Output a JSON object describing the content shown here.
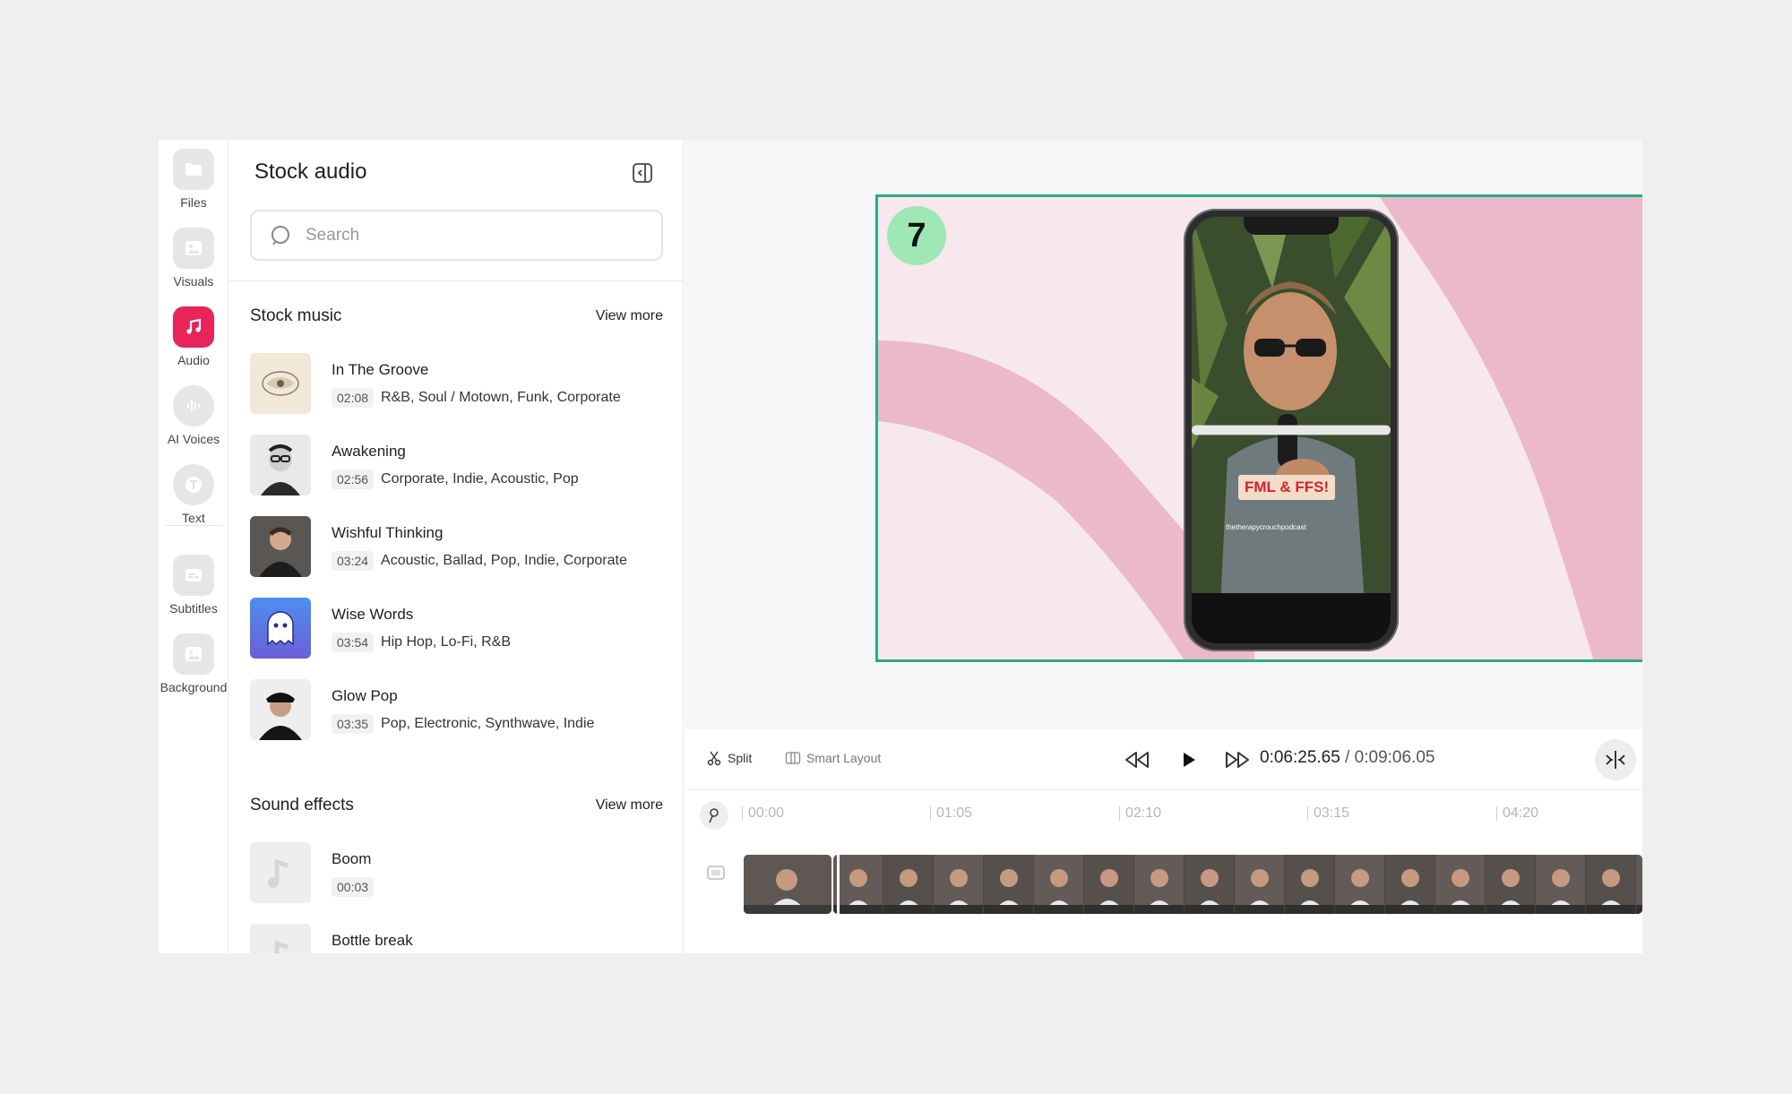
{
  "rail": {
    "items": [
      {
        "label": "Files",
        "icon": "folder-icon"
      },
      {
        "label": "Visuals",
        "icon": "image-icon"
      },
      {
        "label": "Audio",
        "icon": "music-note-icon",
        "active": true
      },
      {
        "label": "AI Voices",
        "icon": "waveform-icon"
      },
      {
        "label": "Text",
        "icon": "text-icon"
      },
      {
        "label": "Subtitles",
        "icon": "subtitles-icon"
      },
      {
        "label": "Background",
        "icon": "background-image-icon"
      }
    ]
  },
  "panel": {
    "title": "Stock audio",
    "search_placeholder": "Search",
    "stock_music": {
      "title": "Stock music",
      "view_more": "View more",
      "tracks": [
        {
          "name": "In The Groove",
          "duration": "02:08",
          "tags": "R&B, Soul / Motown, Funk, Corporate"
        },
        {
          "name": "Awakening",
          "duration": "02:56",
          "tags": "Corporate, Indie, Acoustic, Pop"
        },
        {
          "name": "Wishful Thinking",
          "duration": "03:24",
          "tags": "Acoustic, Ballad, Pop, Indie, Corporate"
        },
        {
          "name": "Wise Words",
          "duration": "03:54",
          "tags": "Hip Hop, Lo-Fi, R&B"
        },
        {
          "name": "Glow Pop",
          "duration": "03:35",
          "tags": "Pop, Electronic, Synthwave, Indie"
        }
      ]
    },
    "sound_effects": {
      "title": "Sound effects",
      "view_more": "View more",
      "tracks": [
        {
          "name": "Boom",
          "duration": "00:03"
        },
        {
          "name": "Bottle break",
          "duration": ""
        }
      ]
    }
  },
  "preview": {
    "badge": "7",
    "caption": "FML & FFS!",
    "username": "thetherapycrouchpodcast"
  },
  "controls": {
    "split_label": "Split",
    "smart_layout_label": "Smart Layout",
    "current_time": "0:06:25.65",
    "separator": " / ",
    "total_time": "0:09:06.05"
  },
  "timeline": {
    "ticks": [
      "00:00",
      "01:05",
      "02:10",
      "03:15",
      "04:20"
    ]
  },
  "colors": {
    "accent": "#e8245a",
    "stage_border": "#2bab87",
    "badge": "#9fe7b4",
    "pink_wave": "#ecb8cb"
  }
}
